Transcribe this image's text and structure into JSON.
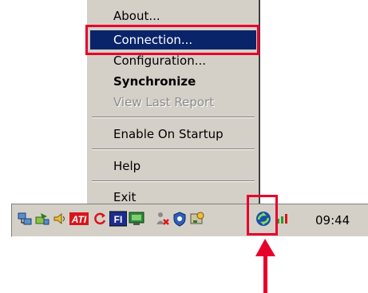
{
  "menu": {
    "items": [
      {
        "label": "About...",
        "style": "normal"
      },
      {
        "label": "Connection...",
        "style": "selected"
      },
      {
        "label": "Configuration...",
        "style": "normal"
      },
      {
        "label": "Synchronize",
        "style": "bold"
      },
      {
        "label": "View Last Report",
        "style": "disabled"
      },
      {
        "label": "Enable On Startup",
        "style": "normal"
      },
      {
        "label": "Help",
        "style": "normal"
      },
      {
        "label": "Exit",
        "style": "normal"
      }
    ]
  },
  "tray": {
    "ati_label": "ATI",
    "fi_label": "FI",
    "clock": "09:44",
    "icons": [
      "network-icon",
      "network-sync-icon",
      "volume-icon",
      "ati-icon",
      "refresh-icon",
      "fi-icon",
      "monitor-icon",
      "person-x-icon",
      "shield-icon",
      "hardware-icon",
      "sync-app-icon",
      "signal-icon"
    ]
  },
  "colors": {
    "highlight": "#e8002c",
    "selection": "#0a246a",
    "menu_bg": "#d4d0c8"
  }
}
